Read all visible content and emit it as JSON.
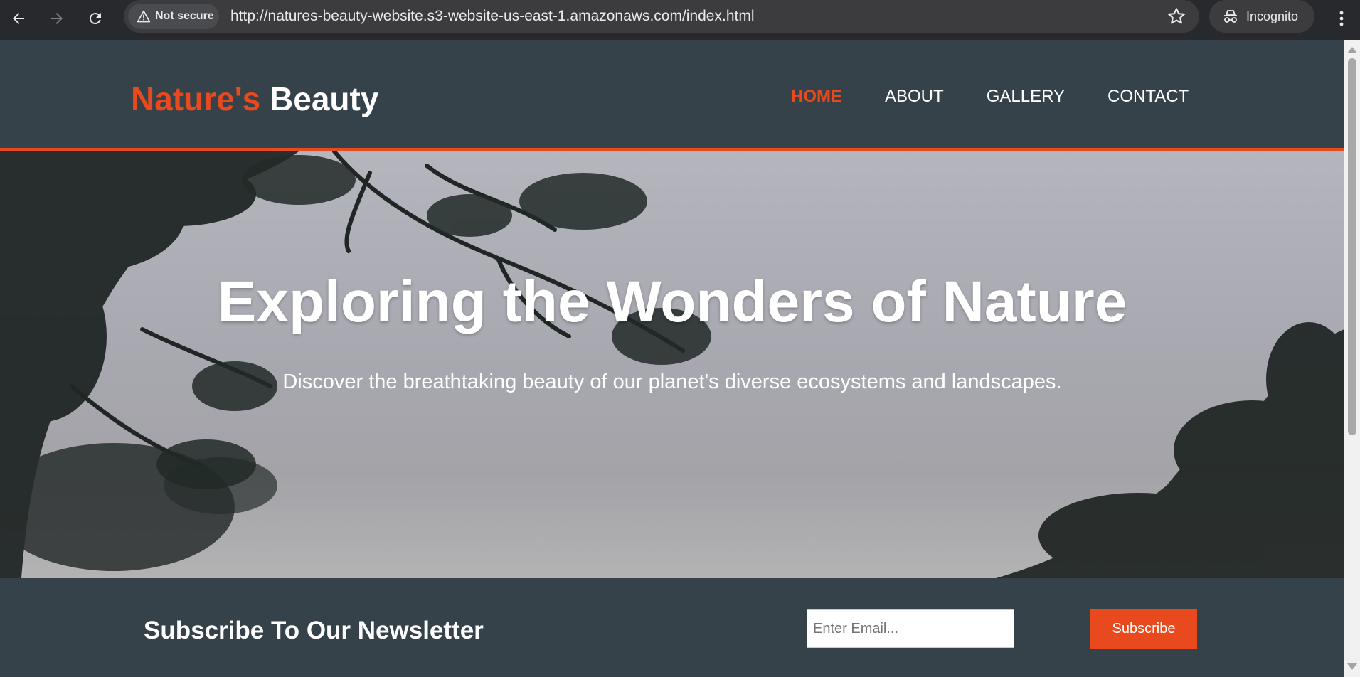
{
  "browser": {
    "security_label": "Not secure",
    "url": "http://natures-beauty-website.s3-website-us-east-1.amazonaws.com/index.html",
    "profile_label": "Incognito"
  },
  "site": {
    "logo_highlight": "Nature's",
    "logo_rest": "Beauty",
    "nav": [
      {
        "label": "HOME",
        "active": true
      },
      {
        "label": "ABOUT",
        "active": false
      },
      {
        "label": "GALLERY",
        "active": false
      },
      {
        "label": "CONTACT",
        "active": false
      }
    ],
    "accent_color": "#e8491d",
    "header_bg": "#35424a"
  },
  "hero": {
    "title": "Exploring the Wonders of Nature",
    "subtitle": "Discover the breathtaking beauty of our planet's diverse ecosystems and landscapes."
  },
  "newsletter": {
    "title": "Subscribe To Our Newsletter",
    "email_placeholder": "Enter Email...",
    "button_label": "Subscribe"
  },
  "icons": [
    "back-arrow-icon",
    "forward-arrow-icon",
    "reload-icon",
    "warning-icon",
    "bookmark-star-icon",
    "incognito-icon",
    "kebab-menu-icon"
  ]
}
